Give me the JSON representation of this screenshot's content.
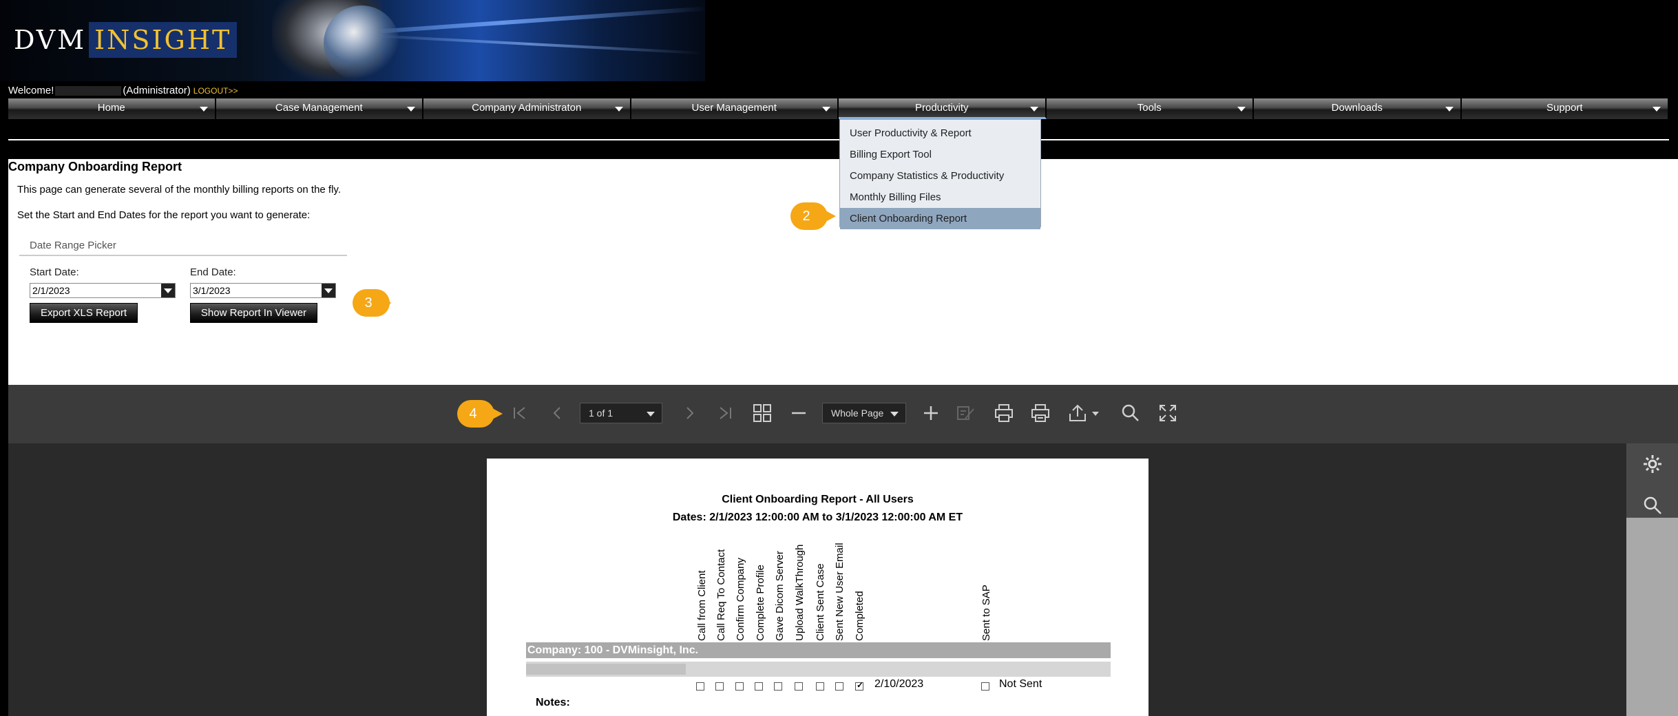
{
  "app": {
    "logo_left": "DVM",
    "logo_right": "INSIGHT"
  },
  "header": {
    "welcome_prefix": "Welcome!",
    "role": "(Administrator)",
    "logout": "LOGOUT>>"
  },
  "nav": {
    "items": [
      "Home",
      "Case Management",
      "Company Administraton",
      "User Management",
      "Productivity",
      "Tools",
      "Downloads",
      "Support"
    ],
    "active": "Productivity"
  },
  "productivity_menu": {
    "items": [
      "User Productivity & Report",
      "Billing Export Tool",
      "Company Statistics & Productivity",
      "Monthly Billing Files",
      "Client Onboarding Report"
    ],
    "highlighted": "Client Onboarding Report"
  },
  "page": {
    "title": "Company Onboarding Report",
    "intro": "This page can generate several of the monthly billing reports on the fly.",
    "instruction": "Set the Start and End Dates for the report you want to generate:",
    "picker_legend": "Date Range Picker",
    "start_label": "Start Date:",
    "start_value": "2/1/2023",
    "end_label": "End Date:",
    "end_value": "3/1/2023",
    "export_button": "Export XLS Report",
    "show_button": "Show Report In Viewer"
  },
  "callouts": {
    "c2": "2",
    "c3": "3",
    "c4": "4"
  },
  "viewer": {
    "page_indicator": "1 of 1",
    "zoom": "Whole Page",
    "toolbar_icons": [
      "first-page-icon",
      "prev-page-icon",
      "next-page-icon",
      "last-page-icon",
      "multipage-icon",
      "zoom-out-icon",
      "zoom-in-icon",
      "edit-icon",
      "print-icon",
      "print-page-icon",
      "export-icon",
      "search-icon",
      "fullscreen-icon"
    ],
    "side_icons": [
      "gear-icon",
      "search-icon"
    ]
  },
  "report": {
    "title": "Client Onboarding Report - All Users",
    "dates": "Dates: 2/1/2023 12:00:00 AM to 3/1/2023 12:00:00 AM ET",
    "columns": [
      "Call from Client",
      "Call Req To Contact",
      "Confirm Company",
      "Complete Profile",
      "Gave Dicom Server",
      "Upload WalkThrough",
      "Client Sent Case",
      "Sent New User Email",
      "Completed",
      "Sent to SAP"
    ],
    "company_row": "Company: 100 - DVMinsight, Inc.",
    "row": {
      "checks": [
        false,
        false,
        false,
        false,
        false,
        false,
        false,
        false,
        true
      ],
      "completed_date": "2/10/2023",
      "sap_checked": false,
      "sap_status": "Not Sent"
    },
    "notes_label": "Notes:"
  },
  "colors": {
    "accent_gold": "#f1c232",
    "callout_orange": "#f5a716",
    "menu_highlight": "#8fa6bf",
    "logo_blue": "#16306b"
  }
}
